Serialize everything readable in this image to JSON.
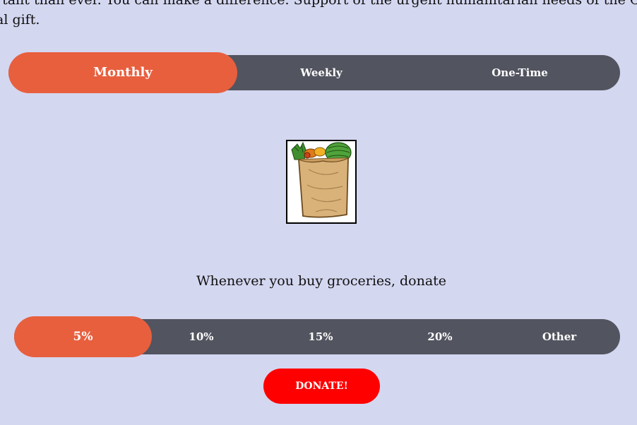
{
  "intro": {
    "line1": "rtant than ever. You can make a difference. Support of the urgent humanitarian needs of the Ch",
    "line2": "al gift."
  },
  "frequency": {
    "options": [
      "Monthly",
      "Weekly",
      "One-Time"
    ],
    "selected": "Monthly"
  },
  "image": {
    "icon": "grocery-bag-icon"
  },
  "prompt": "Whenever you buy groceries, donate",
  "percentages": {
    "options": [
      "5%",
      "10%",
      "15%",
      "20%",
      "Other"
    ],
    "selected": "5%"
  },
  "donate_label": "DONATE!",
  "colors": {
    "background": "#d4d7f0",
    "bar": "#52545f",
    "active": "#e85f3e",
    "donate": "#ff0000"
  }
}
